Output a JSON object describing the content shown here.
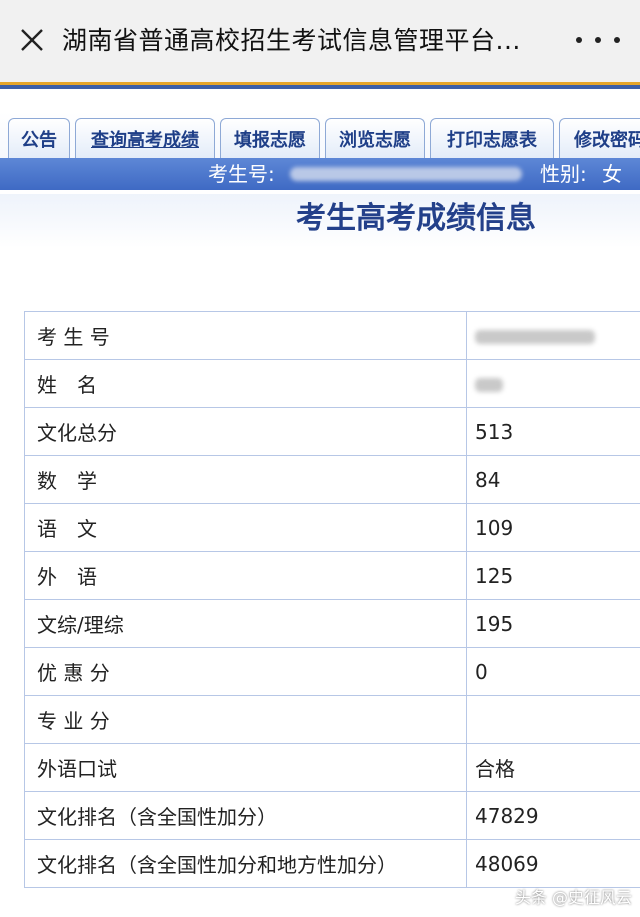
{
  "window": {
    "title": "湖南省普通高校招生考试信息管理平台..."
  },
  "tabs": [
    {
      "label": "公告"
    },
    {
      "label": "查询高考成绩"
    },
    {
      "label": "填报志愿"
    },
    {
      "label": "浏览志愿"
    },
    {
      "label": "打印志愿表"
    },
    {
      "label": "修改密码"
    }
  ],
  "infobar": {
    "exam_no_label": "考生号:",
    "gender_label": "性别:",
    "gender_value": "女",
    "clipped": "&"
  },
  "heading": "考生高考成绩信息",
  "scores": [
    {
      "label": "考 生 号",
      "value": ""
    },
    {
      "label": "姓　名",
      "value": ""
    },
    {
      "label": "文化总分",
      "value": "513"
    },
    {
      "label": "数　学",
      "value": "84"
    },
    {
      "label": "语　文",
      "value": "109"
    },
    {
      "label": "外　语",
      "value": "125"
    },
    {
      "label": "文综/理综",
      "value": "195"
    },
    {
      "label": "优 惠 分",
      "value": "0"
    },
    {
      "label": "专 业 分",
      "value": ""
    },
    {
      "label": "外语口试",
      "value": "合格"
    },
    {
      "label": "文化排名（含全国性加分）",
      "value": "47829"
    },
    {
      "label": "文化排名（含全国性加分和地方性加分）",
      "value": "48069"
    }
  ],
  "watermark": {
    "text": "头条 @史征风云"
  },
  "colors": {
    "tab_text": "#1f3f88",
    "infobar": "#4a74cc",
    "heading": "#23408a",
    "table_border": "#b7c7e6",
    "header_stripe": "#e5a52a"
  }
}
